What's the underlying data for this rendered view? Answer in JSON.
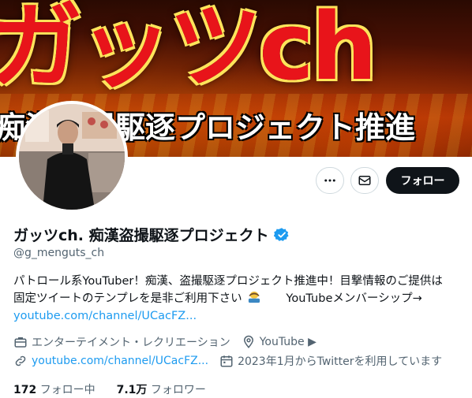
{
  "banner": {
    "title": "ガッツch",
    "subtitle": "痴漢盗撮駆逐プロジェクト推進"
  },
  "actions": {
    "follow_label": "フォロー"
  },
  "profile": {
    "display_name": "ガッツch. 痴漢盗撮駆逐プロジェクト",
    "handle": "@g_menguts_ch",
    "bio_line1": "パトロール系YouTuber！痴漢、盗撮駆逐プロジェクト推進中！目撃情報のご提供は",
    "bio_line2": "固定ツイートのテンプレを是非ご利用下さい",
    "bio_line2_tail": "YouTubeメンバーシップ→",
    "bio_link": "youtube.com/channel/UCacFZ...",
    "category": "エンターテイメント・レクリエーション",
    "location": "YouTube ▶",
    "website": "youtube.com/channel/UCacFZ...",
    "joined": "2023年1月からTwitterを利用しています"
  },
  "stats": {
    "following_count": "172",
    "following_label": "フォロー中",
    "followers_count": "7.1万",
    "followers_label": "フォロワー"
  },
  "colors": {
    "accent": "#1d9bf0",
    "text": "#0f1419",
    "muted": "#536471",
    "verified": "#1d9bf0",
    "banner_red": "#e8141a"
  },
  "icons": [
    "more-icon",
    "mail-icon",
    "verified-badge-icon",
    "briefcase-icon",
    "location-icon",
    "link-icon",
    "calendar-icon"
  ]
}
